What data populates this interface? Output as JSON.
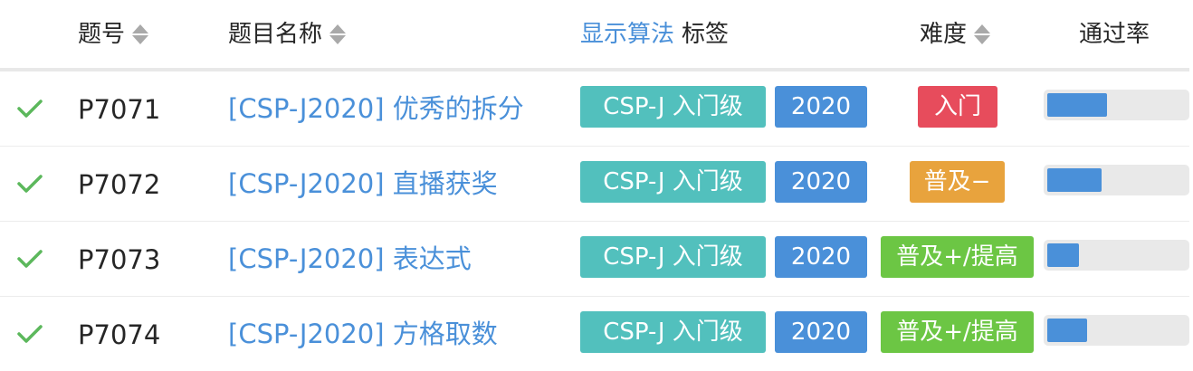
{
  "header": {
    "pid": "题号",
    "name": "题目名称",
    "show_algorithm": "显示算法",
    "tags": "标签",
    "difficulty": "难度",
    "pass_rate": "通过率"
  },
  "colors": {
    "accent": "#4a90d9",
    "tag_level": "#52c0bd",
    "tag_year": "#4a90d9",
    "check": "#5cb85c",
    "diff_entry": "#e74c5c",
    "diff_popular_minus": "#e8a33d",
    "diff_popular_plus": "#6cc644"
  },
  "rows": [
    {
      "status_icon": "check-icon",
      "pid": "P7071",
      "title": "[CSP-J2020] 优秀的拆分",
      "tag_level": "CSP-J 入门级",
      "tag_year": "2020",
      "difficulty": "入门",
      "difficulty_color": "#e74c5c",
      "pass_rate": 0.43
    },
    {
      "status_icon": "check-icon",
      "pid": "P7072",
      "title": "[CSP-J2020] 直播获奖",
      "tag_level": "CSP-J 入门级",
      "tag_year": "2020",
      "difficulty": "普及−",
      "difficulty_color": "#e8a33d",
      "pass_rate": 0.39
    },
    {
      "status_icon": "check-icon",
      "pid": "P7073",
      "title": "[CSP-J2020] 表达式",
      "tag_level": "CSP-J 入门级",
      "tag_year": "2020",
      "difficulty": "普及+/提高",
      "difficulty_color": "#6cc644",
      "pass_rate": 0.23
    },
    {
      "status_icon": "check-icon",
      "pid": "P7074",
      "title": "[CSP-J2020] 方格取数",
      "tag_level": "CSP-J 入门级",
      "tag_year": "2020",
      "difficulty": "普及+/提高",
      "difficulty_color": "#6cc644",
      "pass_rate": 0.29
    }
  ]
}
